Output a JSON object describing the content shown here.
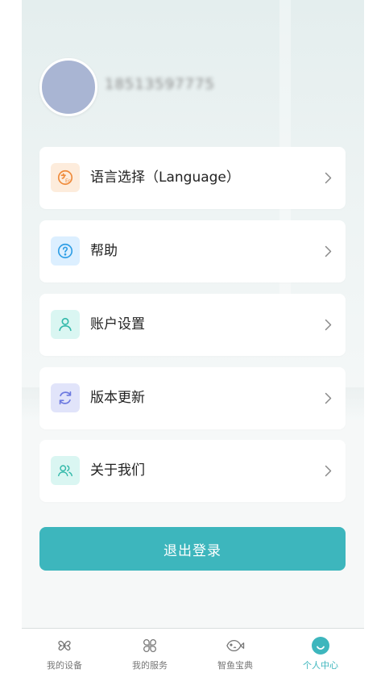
{
  "profile": {
    "phone_number": "18513597775"
  },
  "menu": [
    {
      "label": "语言选择（Language）",
      "icon": "language-icon",
      "icon_color": "#ef8a3a",
      "icon_bg": "#fdecdc"
    },
    {
      "label": "帮助",
      "icon": "help-icon",
      "icon_color": "#2f9ee5",
      "icon_bg": "#dcefff"
    },
    {
      "label": "账户设置",
      "icon": "user-icon",
      "icon_color": "#33b9aa",
      "icon_bg": "#daf6f2"
    },
    {
      "label": "版本更新",
      "icon": "refresh-icon",
      "icon_color": "#6d7ae0",
      "icon_bg": "#e1e4fa"
    },
    {
      "label": "关于我们",
      "icon": "team-icon",
      "icon_color": "#33b9aa",
      "icon_bg": "#daf6f2"
    }
  ],
  "logout": {
    "label": "退出登录",
    "color": "#3db6bd"
  },
  "tabbar": {
    "active_color": "#3db6bd",
    "tabs": [
      {
        "label": "我的设备",
        "icon": "fan-icon",
        "active": false
      },
      {
        "label": "我的服务",
        "icon": "grid-knot-icon",
        "active": false
      },
      {
        "label": "智鱼宝典",
        "icon": "fish-icon",
        "active": false
      },
      {
        "label": "个人中心",
        "icon": "smile-icon",
        "active": true
      }
    ]
  }
}
